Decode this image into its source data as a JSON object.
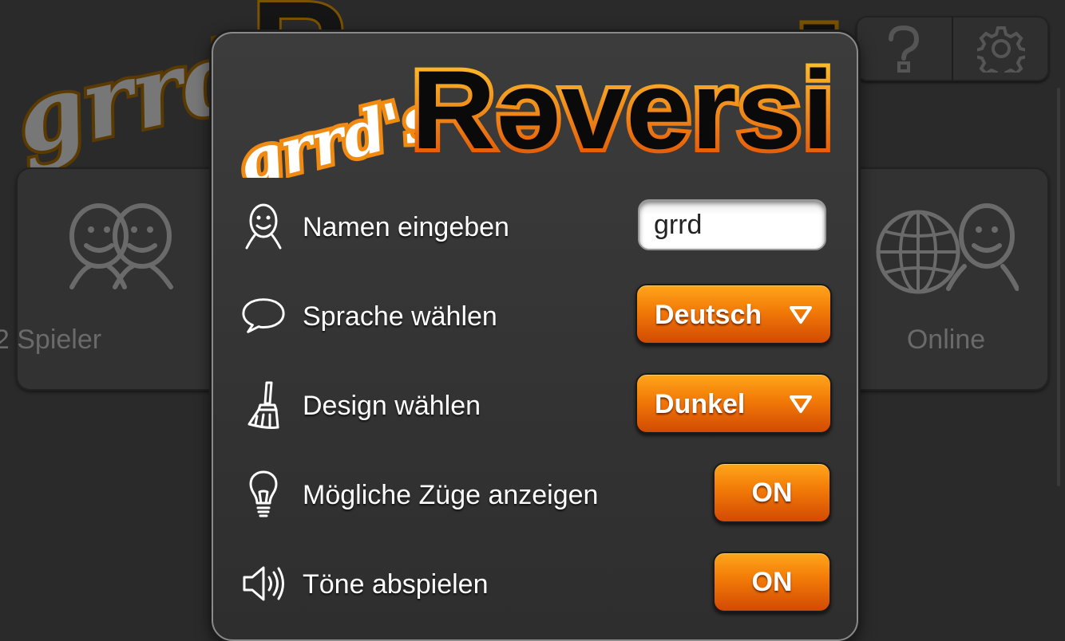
{
  "background": {
    "cards": [
      {
        "label": "2 Spieler",
        "icon": "two-faces-icon"
      },
      {
        "label": "Online",
        "icon": "globe-face-icon"
      }
    ],
    "top_buttons": [
      {
        "icon": "help-icon"
      },
      {
        "icon": "gear-icon"
      }
    ]
  },
  "modal": {
    "logo": {
      "prefix": "grrd's",
      "title": "Rəversi"
    },
    "settings": [
      {
        "icon": "smiley-face-icon",
        "label": "Namen eingeben",
        "control": "input",
        "value": "grrd"
      },
      {
        "icon": "speech-bubble-icon",
        "label": "Sprache wählen",
        "control": "select",
        "value": "Deutsch"
      },
      {
        "icon": "brush-icon",
        "label": "Design wählen",
        "control": "select",
        "value": "Dunkel"
      },
      {
        "icon": "lightbulb-icon",
        "label": "Mögliche Züge anzeigen",
        "control": "toggle",
        "value": "ON"
      },
      {
        "icon": "speaker-icon",
        "label": "Töne abspielen",
        "control": "toggle",
        "value": "ON"
      }
    ]
  },
  "colors": {
    "accent_orange": "#f27a07",
    "accent_dark_orange": "#d24a04",
    "background": "#2a2a2a",
    "modal": "#3a3a3a"
  }
}
